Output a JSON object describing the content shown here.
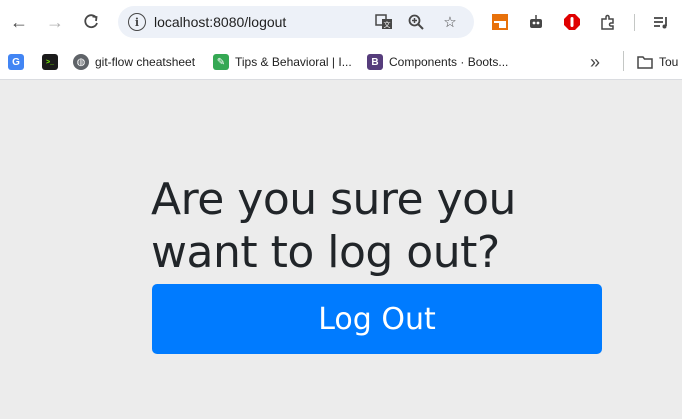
{
  "browser": {
    "url": "localhost:8080/logout",
    "bookmarks": [
      {
        "label": "",
        "icon": "google-translate-icon",
        "color": "#4285f4"
      },
      {
        "label": "",
        "icon": "terminal-icon",
        "color": "#1b1b1b"
      },
      {
        "label": "git-flow cheatsheet",
        "icon": "globe-icon",
        "color": "#5f6368"
      },
      {
        "label": "Tips & Behavioral | I...",
        "icon": "evernote-icon",
        "color": "#34a853"
      },
      {
        "label": "Components · Boots...",
        "icon": "bootstrap-icon",
        "color": "#563d7c",
        "glyph": "B"
      }
    ],
    "overflow_label": "»",
    "folder_label": "Tou"
  },
  "page": {
    "heading": "Are you sure you want to log out?",
    "button_label": "Log Out",
    "accent_color": "#007bff"
  }
}
